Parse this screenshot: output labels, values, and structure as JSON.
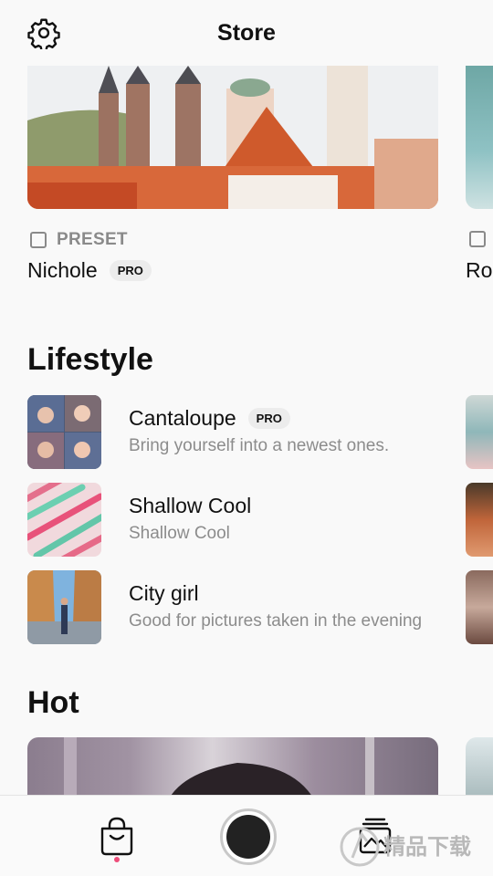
{
  "header": {
    "title": "Store",
    "settings_icon": "gear-icon"
  },
  "featured": {
    "cards": [
      {
        "name": "Nichole",
        "tag": "PRESET",
        "badge": "PRO"
      },
      {
        "name": "Ro"
      }
    ]
  },
  "lifestyle": {
    "title": "Lifestyle",
    "items": [
      {
        "name": "Cantaloupe",
        "badge": "PRO",
        "desc": "Bring yourself into a newest ones."
      },
      {
        "name": "Shallow Cool",
        "desc": "Shallow Cool"
      },
      {
        "name": "City girl",
        "desc": "Good for pictures taken in the evening"
      }
    ]
  },
  "hot": {
    "title": "Hot"
  },
  "bottom_nav": {
    "items": [
      "store-bag-icon",
      "shutter-button",
      "gallery-stack-icon"
    ],
    "active_indicator_color": "#ee4d7a"
  },
  "watermark": {
    "text": "精品下载",
    "icon": "watermark-logo-icon"
  }
}
